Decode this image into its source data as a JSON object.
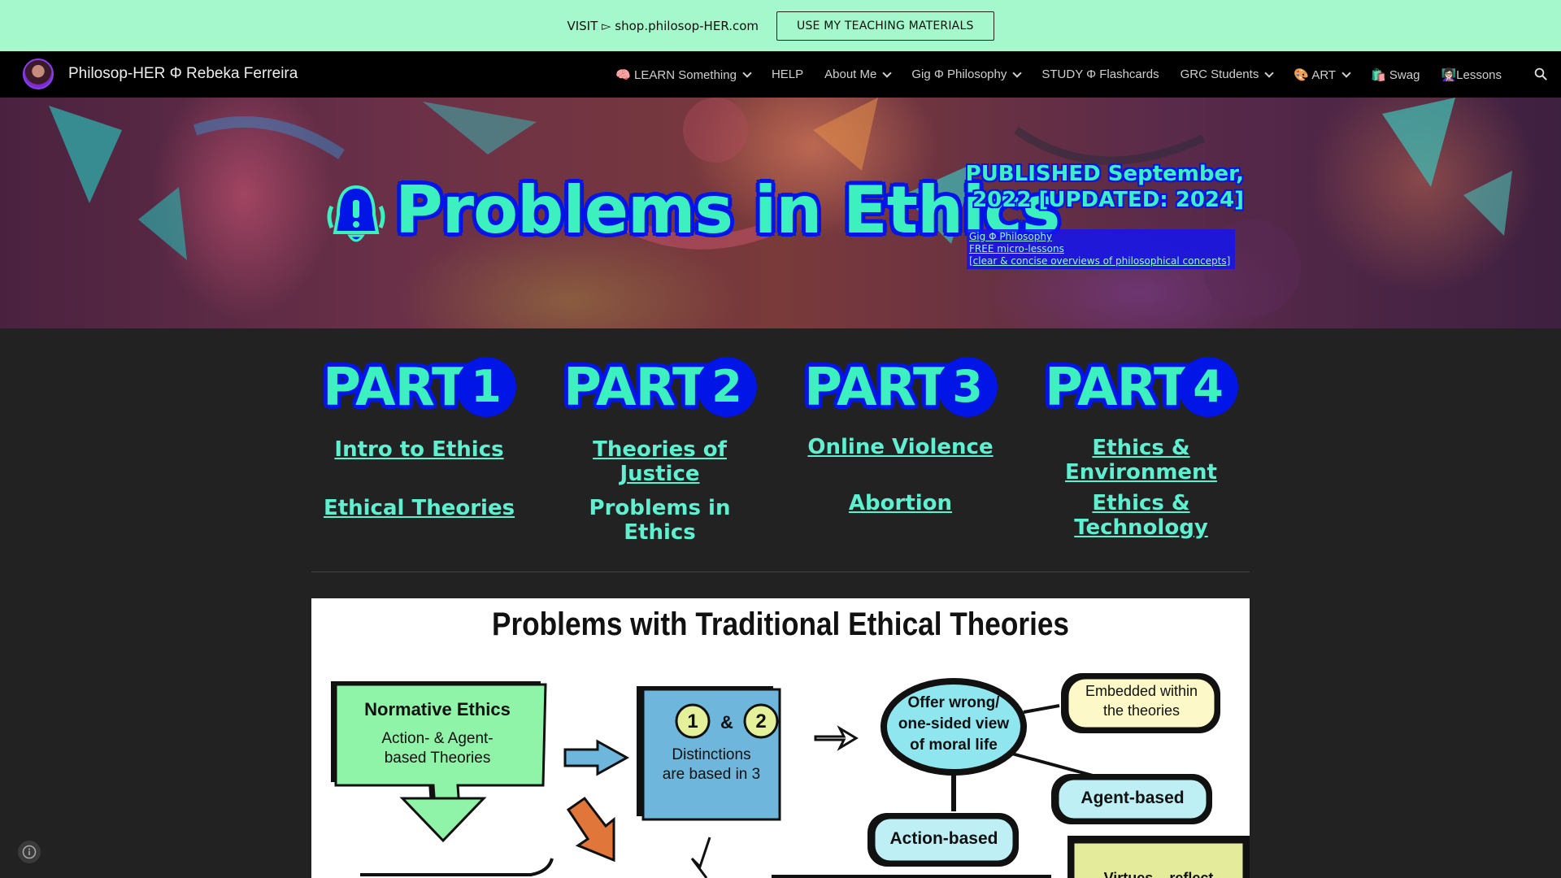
{
  "announcement": {
    "text": "VISIT ▻ shop.philosop-HER.com",
    "button_label": "USE MY TEACHING MATERIALS"
  },
  "nav": {
    "site_title": "Philosop-HER Φ Rebeka Ferreira",
    "items": [
      {
        "label": "🧠 LEARN Something",
        "has_dropdown": true
      },
      {
        "label": "HELP",
        "has_dropdown": false
      },
      {
        "label": "About Me",
        "has_dropdown": true
      },
      {
        "label": "Gig Φ Philosophy",
        "has_dropdown": true
      },
      {
        "label": "STUDY Φ Flashcards",
        "has_dropdown": false
      },
      {
        "label": "GRC Students",
        "has_dropdown": true
      },
      {
        "label": "🎨 ART",
        "has_dropdown": true
      },
      {
        "label": "🛍️ Swag",
        "has_dropdown": false
      },
      {
        "label": "👩🏻‍🏫Lessons",
        "has_dropdown": false
      }
    ],
    "search_icon": "search-icon"
  },
  "hero": {
    "title": "Problems in Ethics",
    "bell_icon": "bell-icon",
    "published_line1": "PUBLISHED September,",
    "published_line2": "2022 [UPDATED: 2024]",
    "note_line1": "Gig Φ Philosophy",
    "note_line2": "FREE micro-lessons",
    "note_line3": "[clear & concise overviews of philosophical concepts]"
  },
  "parts": [
    {
      "word": "PART",
      "num": "1",
      "links": [
        "Intro to Ethics",
        "Ethical Theories"
      ]
    },
    {
      "word": "PART",
      "num": "2",
      "links": [
        "Theories of Justice",
        "Problems in Ethics"
      ]
    },
    {
      "word": "PART",
      "num": "3",
      "links": [
        "Online Violence",
        "Abortion"
      ]
    },
    {
      "word": "PART",
      "num": "4",
      "links": [
        "Ethics & Environment",
        "Ethics & Technology"
      ]
    }
  ],
  "infographic": {
    "title": "Problems with Traditional Ethical Theories",
    "normative_title": "Normative Ethics",
    "normative_line1": "Action- & Agent-",
    "normative_line2": "based Theories",
    "dist_num1": "1",
    "dist_amp": "&",
    "dist_num2": "2",
    "dist_line1": "Distinctions",
    "dist_line2": "are based in 3",
    "offer_line1": "Offer wrong/",
    "offer_line2": "one-sided view",
    "offer_line3": "of moral life",
    "embedded_line1": "Embedded within",
    "embedded_line2": "the theories",
    "agent_based": "Agent-based",
    "action_based": "Action-based",
    "virtues_partial": "Virtues – reflect"
  },
  "colors": {
    "announce_bg": "#a4f8cb",
    "nav_bg": "#000000",
    "page_bg": "#222222",
    "accent_mint": "#3cf0c0",
    "accent_blue": "#0015e6"
  }
}
